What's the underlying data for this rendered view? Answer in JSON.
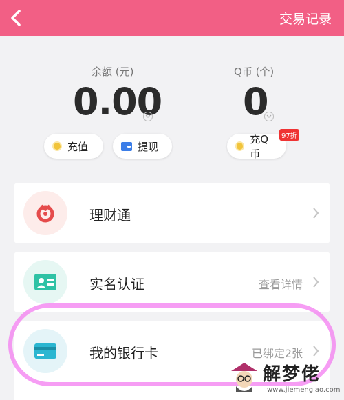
{
  "header": {
    "back_icon": "back-arrow-icon",
    "title": "交易记录",
    "bg_color": "#f25f85"
  },
  "balance": {
    "label": "余额 (元)",
    "value": "0.00",
    "actions": [
      {
        "label": "充值",
        "icon": "coin-icon"
      },
      {
        "label": "提现",
        "icon": "wallet-icon"
      }
    ]
  },
  "qcoin": {
    "label": "Q币 (个)",
    "value": "0",
    "action": {
      "label": "充Q币",
      "icon": "coin-icon"
    },
    "badge": "97折"
  },
  "menu": {
    "items": [
      {
        "title": "理财通",
        "hint": "",
        "icon": "licaitong-icon"
      },
      {
        "title": "实名认证",
        "hint": "查看详情",
        "icon": "id-card-icon"
      },
      {
        "title": "我的银行卡",
        "hint": "已绑定2张",
        "icon": "bank-card-icon"
      }
    ]
  },
  "watermark": {
    "text": "解梦佬",
    "url": "www.jiemenglao.com"
  }
}
